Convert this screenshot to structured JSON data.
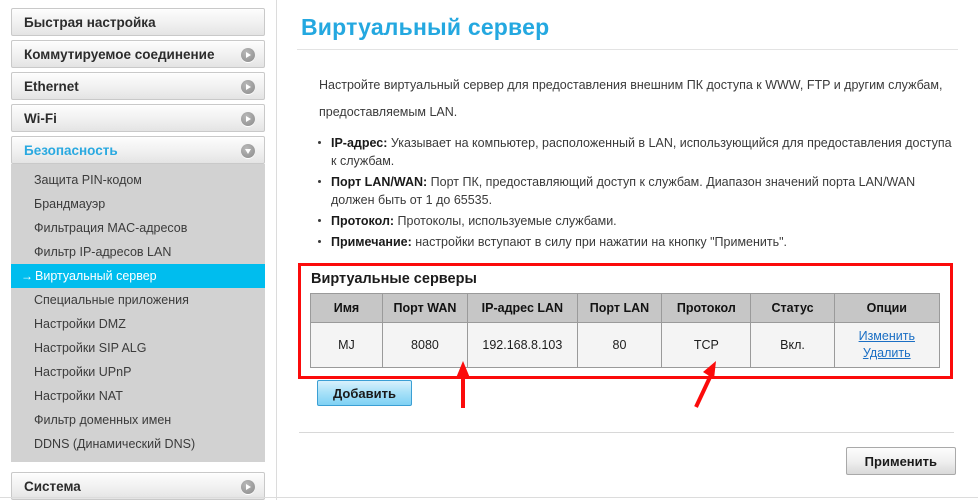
{
  "colors": {
    "accent": "#24a8e0",
    "active_nav_bg": "#00bdee",
    "annotation_red": "#fb0b0b",
    "link_blue": "#1b6fc4",
    "table_header_bg": "#c6c6c6",
    "subnav_bg": "#d2d2d2",
    "add_button_blue": "#7fd1f4"
  },
  "sidebar": {
    "groups": [
      {
        "label": "Быстрая настройка",
        "icon": null,
        "expanded": false
      },
      {
        "label": "Коммутируемое соединение",
        "icon": "chevron-right-icon",
        "expanded": false
      },
      {
        "label": "Ethernet",
        "icon": "chevron-right-icon",
        "expanded": false
      },
      {
        "label": "Wi-Fi",
        "icon": "chevron-right-icon",
        "expanded": false
      },
      {
        "label": "Безопасность",
        "icon": "chevron-down-icon",
        "expanded": true
      },
      {
        "label": "Система",
        "icon": "chevron-right-icon",
        "expanded": false
      }
    ],
    "security_items": [
      {
        "label": "Защита PIN-кодом",
        "active": false
      },
      {
        "label": "Брандмауэр",
        "active": false
      },
      {
        "label": "Фильтрация MAC-адресов",
        "active": false
      },
      {
        "label": "Фильтр IP-адресов LAN",
        "active": false
      },
      {
        "label": "Виртуальный сервер",
        "active": true,
        "arrow": "→"
      },
      {
        "label": "Специальные приложения",
        "active": false
      },
      {
        "label": "Настройки DMZ",
        "active": false
      },
      {
        "label": "Настройки SIP ALG",
        "active": false
      },
      {
        "label": "Настройки UPnP",
        "active": false
      },
      {
        "label": "Настройки NAT",
        "active": false
      },
      {
        "label": "Фильтр доменных имен",
        "active": false
      },
      {
        "label": "DDNS (Динамический DNS)",
        "active": false
      }
    ]
  },
  "main": {
    "title": "Виртуальный сервер",
    "intro": "Настройте виртуальный сервер для предоставления внешним ПК доступа к WWW, FTP и другим службам, предоставляемым LAN.",
    "bullets": [
      {
        "term": "IP-адрес:",
        "text": " Указывает на компьютер, расположенный в LAN, использующийся для предоставления доступа к службам."
      },
      {
        "term": "Порт LAN/WAN:",
        "text": " Порт ПК, предоставляющий доступ к службам. Диапазон значений порта LAN/WAN должен быть от 1 до 65535."
      },
      {
        "term": "Протокол:",
        "text": " Протоколы, используемые службами."
      },
      {
        "term": "Примечание:",
        "text": " настройки вступают в силу при нажатии на кнопку \"Применить\"."
      }
    ],
    "panel": {
      "title": "Виртуальные серверы",
      "columns": [
        "Имя",
        "Порт WAN",
        "IP-адрес LAN",
        "Порт LAN",
        "Протокол",
        "Статус",
        "Опции"
      ],
      "rows": [
        {
          "name": "MJ",
          "wan_port": "8080",
          "lan_ip": "192.168.8.103",
          "lan_port": "80",
          "protocol": "TCP",
          "status": "Вкл.",
          "options": [
            "Изменить",
            "Удалить"
          ]
        }
      ]
    },
    "add_button": "Добавить",
    "apply_button": "Применить"
  },
  "annotations": {
    "arrows": [
      {
        "name": "arrow-wan-port",
        "points_to": "8080"
      },
      {
        "name": "arrow-protocol",
        "points_to": "TCP"
      }
    ],
    "highlight_box": "Виртуальные серверы"
  }
}
